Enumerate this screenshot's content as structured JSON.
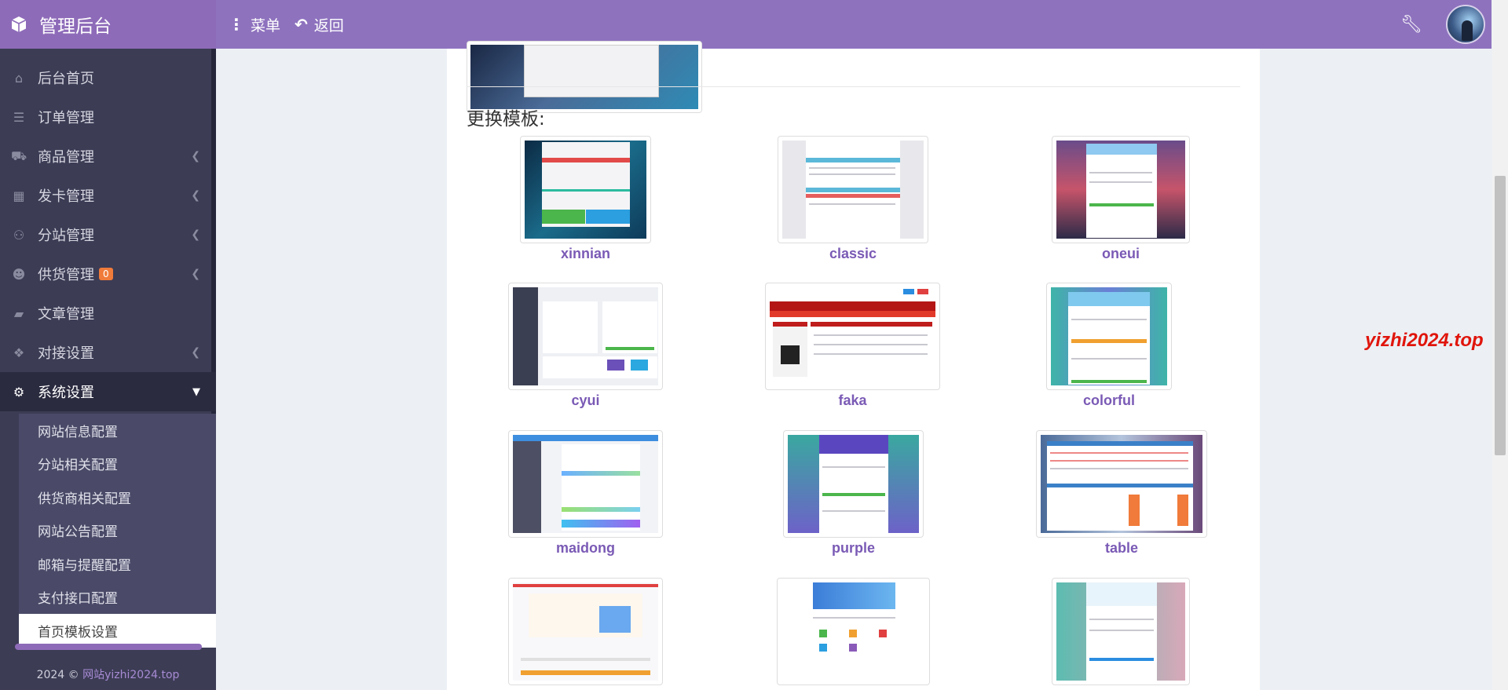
{
  "header": {
    "brand": "管理后台",
    "menu_label": "菜单",
    "back_label": "返回"
  },
  "sidebar": {
    "items": [
      {
        "label": "后台首页",
        "icon": "home-icon"
      },
      {
        "label": "订单管理",
        "icon": "list-icon"
      },
      {
        "label": "商品管理",
        "icon": "cart-icon"
      },
      {
        "label": "发卡管理",
        "icon": "grid-icon"
      },
      {
        "label": "分站管理",
        "icon": "sitemap-icon"
      },
      {
        "label": "供货管理",
        "icon": "users-icon",
        "badge": "0"
      },
      {
        "label": "文章管理",
        "icon": "book-icon"
      },
      {
        "label": "对接设置",
        "icon": "cubes-icon"
      },
      {
        "label": "系统设置",
        "icon": "gear-icon"
      }
    ],
    "submenu": [
      "网站信息配置",
      "分站相关配置",
      "供货商相关配置",
      "网站公告配置",
      "邮箱与提醒配置",
      "支付接口配置",
      "首页模板设置"
    ],
    "footer_prefix": "2024 © ",
    "footer_link": "网站yizhi2024.top"
  },
  "content": {
    "section_title": "更换模板:",
    "templates": [
      {
        "name": "xinnian"
      },
      {
        "name": "classic"
      },
      {
        "name": "oneui"
      },
      {
        "name": "cyui"
      },
      {
        "name": "faka"
      },
      {
        "name": "colorful"
      },
      {
        "name": "maidong"
      },
      {
        "name": "purple"
      },
      {
        "name": "table"
      }
    ]
  },
  "watermark": "yizhi2024.top",
  "colors": {
    "header": "#8e72be",
    "sidebar": "#3c3c55",
    "template_name": "#7a5ab5",
    "watermark": "#e0150c"
  }
}
